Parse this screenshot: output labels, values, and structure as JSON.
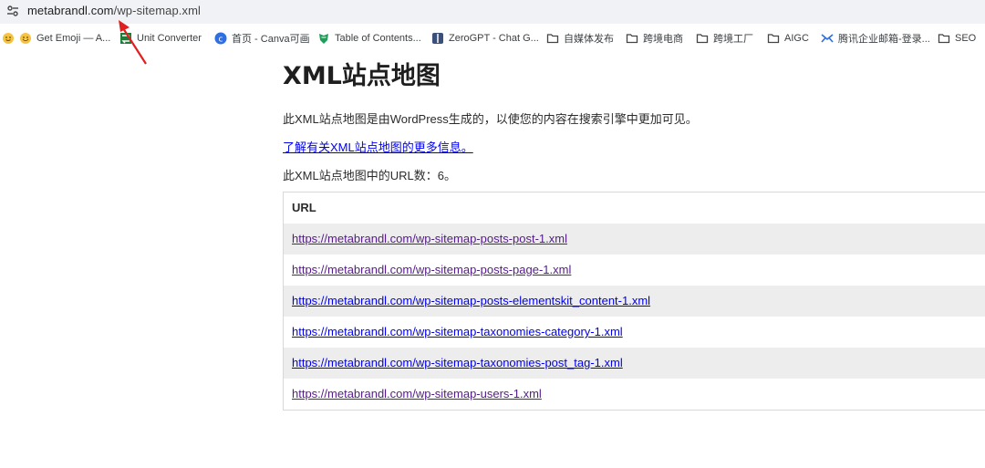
{
  "browser": {
    "address": {
      "domain": "metabrandl.com",
      "path": "/wp-sitemap.xml"
    },
    "bookmarks": [
      {
        "label": "Get Emoji — A...",
        "icon": "emoji-icon"
      },
      {
        "label": "Unit Converter",
        "icon": "unit-converter-icon"
      },
      {
        "label": "首页 - Canva可画",
        "icon": "canva-icon"
      },
      {
        "label": "Table of Contents...",
        "icon": "shield-icon"
      },
      {
        "label": "ZeroGPT - Chat G...",
        "icon": "zerogpt-icon"
      },
      {
        "label": "自媒体发布",
        "icon": "folder-icon"
      },
      {
        "label": "跨境电商",
        "icon": "folder-icon"
      },
      {
        "label": "跨境工厂",
        "icon": "folder-icon"
      },
      {
        "label": "AIGC",
        "icon": "folder-icon"
      },
      {
        "label": "腾讯企业邮箱-登录...",
        "icon": "tencent-mail-icon"
      },
      {
        "label": "SEO",
        "icon": "folder-icon"
      }
    ]
  },
  "page": {
    "title": "XML站点地图",
    "description": "此XML站点地图是由WordPress生成的，以使您的内容在搜索引擎中更加可见。",
    "learn_more": "了解有关XML站点地图的更多信息。",
    "url_count": "此XML站点地图中的URL数：6。",
    "table": {
      "header": "URL",
      "rows": [
        "https://metabrandl.com/wp-sitemap-posts-post-1.xml",
        "https://metabrandl.com/wp-sitemap-posts-page-1.xml",
        "https://metabrandl.com/wp-sitemap-posts-elementskit_content-1.xml",
        "https://metabrandl.com/wp-sitemap-taxonomies-category-1.xml",
        "https://metabrandl.com/wp-sitemap-taxonomies-post_tag-1.xml",
        "https://metabrandl.com/wp-sitemap-users-1.xml"
      ]
    }
  },
  "colors": {
    "link": "#0000ee",
    "visited": "#551a8b",
    "alt_row": "#ededed",
    "annotation_arrow": "#e02020"
  }
}
